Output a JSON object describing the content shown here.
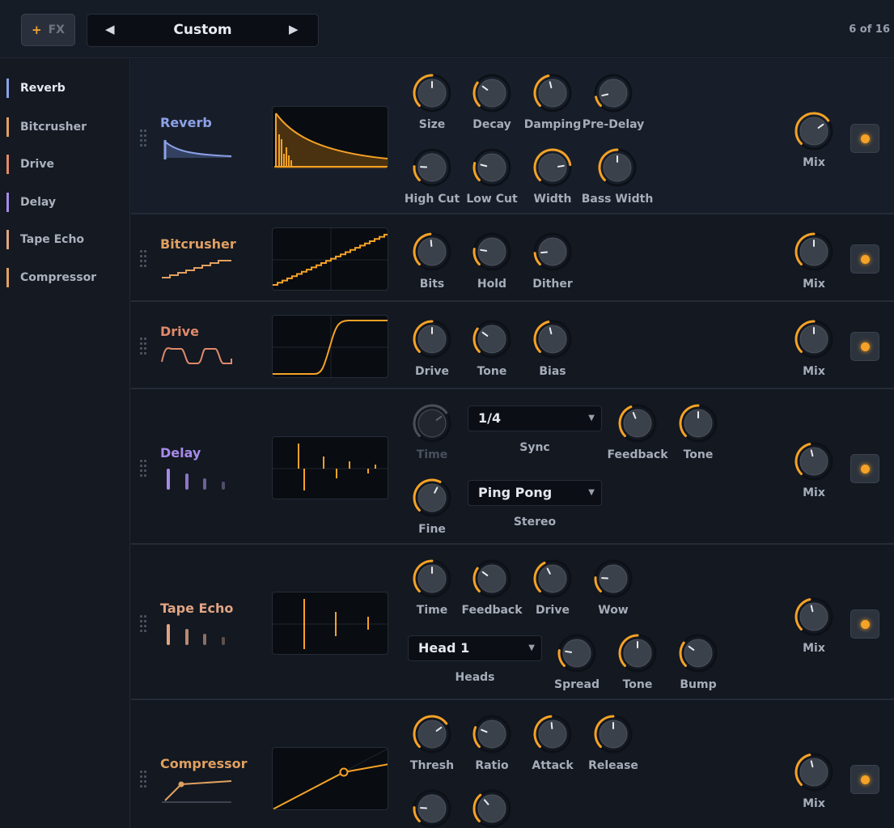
{
  "colors": {
    "accent": "#f5a226",
    "reverb": "#8ca2e8",
    "bitcrusher": "#e0a060",
    "drive": "#e08a6a",
    "delay": "#a68ae8",
    "tape_echo": "#e0a482",
    "compressor": "#e0a060",
    "sidebar_indicator_reverb": "#8ca2e8",
    "sidebar_indicator_bitcrusher": "#e0a060",
    "sidebar_indicator_drive": "#e08a6a",
    "sidebar_indicator_delay": "#a68ae8",
    "sidebar_indicator_tape_echo": "#e0a482",
    "sidebar_indicator_compressor": "#e0a060"
  },
  "toolbar": {
    "fx_button": {
      "icon": "plus-icon",
      "label": "FX"
    },
    "preset": {
      "prev_icon": "triangle-left-icon",
      "name": "Custom",
      "next_icon": "triangle-right-icon"
    },
    "page_count": "6 of 16"
  },
  "sidebar": {
    "items": [
      {
        "label": "Reverb"
      },
      {
        "label": "Bitcrusher"
      },
      {
        "label": "Drive"
      },
      {
        "label": "Delay"
      },
      {
        "label": "Tape Echo"
      },
      {
        "label": "Compressor"
      }
    ]
  },
  "modules": {
    "reverb": {
      "name": "Reverb",
      "knobs": {
        "size": {
          "label": "Size",
          "value": 0.5
        },
        "decay": {
          "label": "Decay",
          "value": 0.3
        },
        "damping": {
          "label": "Damping",
          "value": 0.45
        },
        "pre_delay": {
          "label": "Pre-Delay",
          "value": 0.12
        },
        "high_cut": {
          "label": "High Cut",
          "value": 0.18
        },
        "low_cut": {
          "label": "Low Cut",
          "value": 0.22
        },
        "width": {
          "label": "Width",
          "value": 0.8
        },
        "bass_width": {
          "label": "Bass Width",
          "value": 0.5
        }
      },
      "mix": {
        "label": "Mix",
        "value": 0.7
      }
    },
    "bitcrusher": {
      "name": "Bitcrusher",
      "knobs": {
        "bits": {
          "label": "Bits",
          "value": 0.48
        },
        "hold": {
          "label": "Hold",
          "value": 0.2
        },
        "dither": {
          "label": "Dither",
          "value": 0.15
        }
      },
      "mix": {
        "label": "Mix",
        "value": 0.5
      }
    },
    "drive": {
      "name": "Drive",
      "knobs": {
        "drive": {
          "label": "Drive",
          "value": 0.5
        },
        "tone": {
          "label": "Tone",
          "value": 0.3
        },
        "bias": {
          "label": "Bias",
          "value": 0.45
        }
      },
      "mix": {
        "label": "Mix",
        "value": 0.5
      }
    },
    "delay": {
      "name": "Delay",
      "knobs": {
        "time": {
          "label": "Time",
          "value": 0.7,
          "disabled": true
        },
        "feedback": {
          "label": "Feedback",
          "value": 0.42
        },
        "tone": {
          "label": "Tone",
          "value": 0.5
        },
        "fine": {
          "label": "Fine",
          "value": 0.6
        }
      },
      "sync": {
        "value": "1/4",
        "label": "Sync"
      },
      "stereo": {
        "value": "Ping Pong",
        "label": "Stereo"
      },
      "mix": {
        "label": "Mix",
        "value": 0.45
      }
    },
    "tape_echo": {
      "name": "Tape Echo",
      "knobs": {
        "time": {
          "label": "Time",
          "value": 0.5
        },
        "feedback": {
          "label": "Feedback",
          "value": 0.3
        },
        "drive": {
          "label": "Drive",
          "value": 0.4
        },
        "wow": {
          "label": "Wow",
          "value": 0.18
        },
        "spread": {
          "label": "Spread",
          "value": 0.2
        },
        "tone": {
          "label": "Tone",
          "value": 0.5
        },
        "bump": {
          "label": "Bump",
          "value": 0.3
        }
      },
      "heads": {
        "value": "Head 1",
        "label": "Heads"
      },
      "mix": {
        "label": "Mix",
        "value": 0.45
      }
    },
    "compressor": {
      "name": "Compressor",
      "knobs": {
        "thresh": {
          "label": "Thresh",
          "value": 0.7
        },
        "ratio": {
          "label": "Ratio",
          "value": 0.25
        },
        "attack": {
          "label": "Attack",
          "value": 0.48
        },
        "release": {
          "label": "Release",
          "value": 0.5
        },
        "extra_1": {
          "value": 0.18
        },
        "extra_2": {
          "value": 0.35
        }
      },
      "mix": {
        "label": "Mix",
        "value": 0.45
      }
    }
  }
}
